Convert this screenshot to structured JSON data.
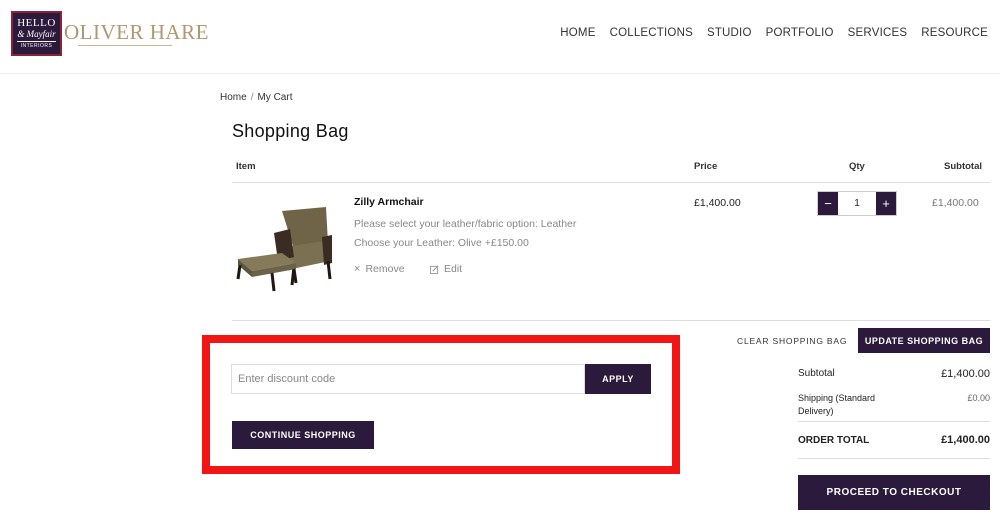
{
  "header": {
    "logo": {
      "line1": "HELLO",
      "line2": "& Mayfair",
      "line3": "INTERIORS"
    },
    "brand": "OLIVER HARE",
    "nav": [
      "HOME",
      "COLLECTIONS",
      "STUDIO",
      "PORTFOLIO",
      "SERVICES",
      "RESOURCE"
    ]
  },
  "breadcrumb": {
    "home": "Home",
    "sep": "/",
    "current": "My Cart"
  },
  "page_title": "Shopping Bag",
  "table": {
    "headers": {
      "item": "Item",
      "price": "Price",
      "qty": "Qty",
      "subtotal": "Subtotal"
    },
    "row": {
      "name": "Zilly Armchair",
      "option1": "Please select your leather/fabric option:  Leather",
      "option2": "Choose your Leather:  Olive +£150.00",
      "remove": "Remove",
      "edit": "Edit",
      "price": "£1,400.00",
      "qty": "1",
      "subtotal": "£1,400.00"
    }
  },
  "discount": {
    "placeholder": "Enter discount code",
    "apply": "APPLY",
    "continue": "CONTINUE SHOPPING"
  },
  "summary": {
    "clear": "CLEAR SHOPPING BAG",
    "update": "UPDATE SHOPPING BAG",
    "subtotal_label": "Subtotal",
    "subtotal_value": "£1,400.00",
    "shipping_label": "Shipping (Standard Delivery)",
    "shipping_value": "£0.00",
    "total_label": "ORDER TOTAL",
    "total_value": "£1,400.00",
    "checkout": "PROCEED TO CHECKOUT"
  },
  "colors": {
    "accent": "#2b1a3b",
    "highlight": "#f21515",
    "brand": "#b19770"
  },
  "icons": {
    "remove": "close-icon",
    "edit": "pencil-icon",
    "minus": "minus-icon",
    "plus": "plus-icon"
  }
}
